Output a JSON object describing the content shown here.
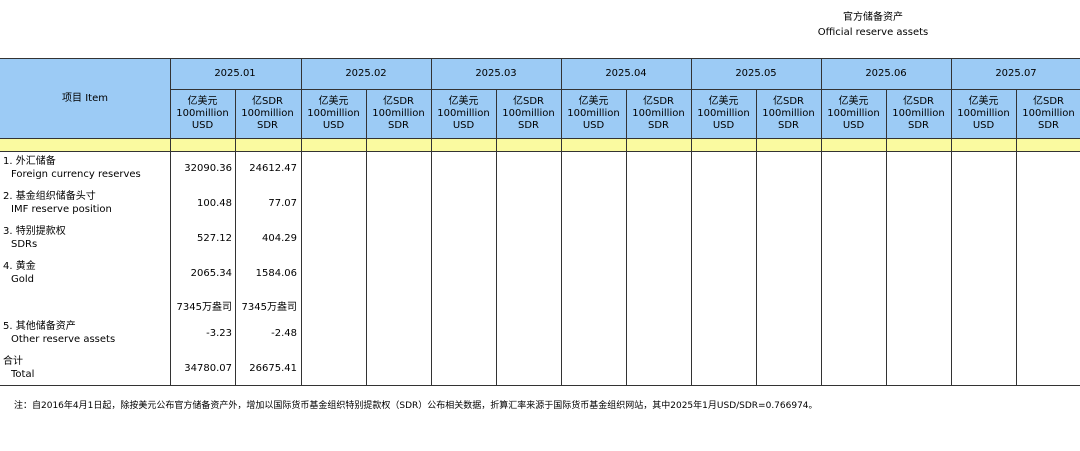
{
  "title": {
    "zh": "官方储备资产",
    "en": "Official reserve assets"
  },
  "header": {
    "item": "项目  Item",
    "months": [
      "2025.01",
      "2025.02",
      "2025.03",
      "2025.04",
      "2025.05",
      "2025.06",
      "2025.07"
    ],
    "unit_usd": [
      "亿美元",
      "100million",
      "USD"
    ],
    "unit_sdr": [
      "亿SDR",
      "100million",
      "SDR"
    ]
  },
  "rows": [
    {
      "zh": "1. 外汇储备",
      "en": "Foreign currency reserves",
      "usd": "32090.36",
      "sdr": "24612.47"
    },
    {
      "zh": "2. 基金组织储备头寸",
      "en": "IMF reserve position",
      "usd": "100.48",
      "sdr": "77.07"
    },
    {
      "zh": "3. 特别提款权",
      "en": "SDRs",
      "usd": "527.12",
      "sdr": "404.29"
    },
    {
      "zh": "4. 黄金",
      "en": "Gold",
      "usd": "2065.34",
      "sdr": "1584.06"
    },
    {
      "zh": "",
      "en": "",
      "usd": "7345万盎司",
      "sdr": "7345万盎司"
    },
    {
      "zh": "5. 其他储备资产",
      "en": "Other reserve assets",
      "usd": "-3.23",
      "sdr": "-2.48"
    },
    {
      "zh": " 合计",
      "en": "Total",
      "usd": "34780.07",
      "sdr": "26675.41"
    }
  ],
  "note": "注：自2016年4月1日起，除按美元公布官方储备资产外，增加以国际货币基金组织特别提款权（SDR）公布相关数据，折算汇率来源于国际货币基金组织网站，其中2025年1月USD/SDR=0.766974。",
  "colors": {
    "header_bg": "#9ccbf5",
    "band_bg": "#fafaa0"
  }
}
